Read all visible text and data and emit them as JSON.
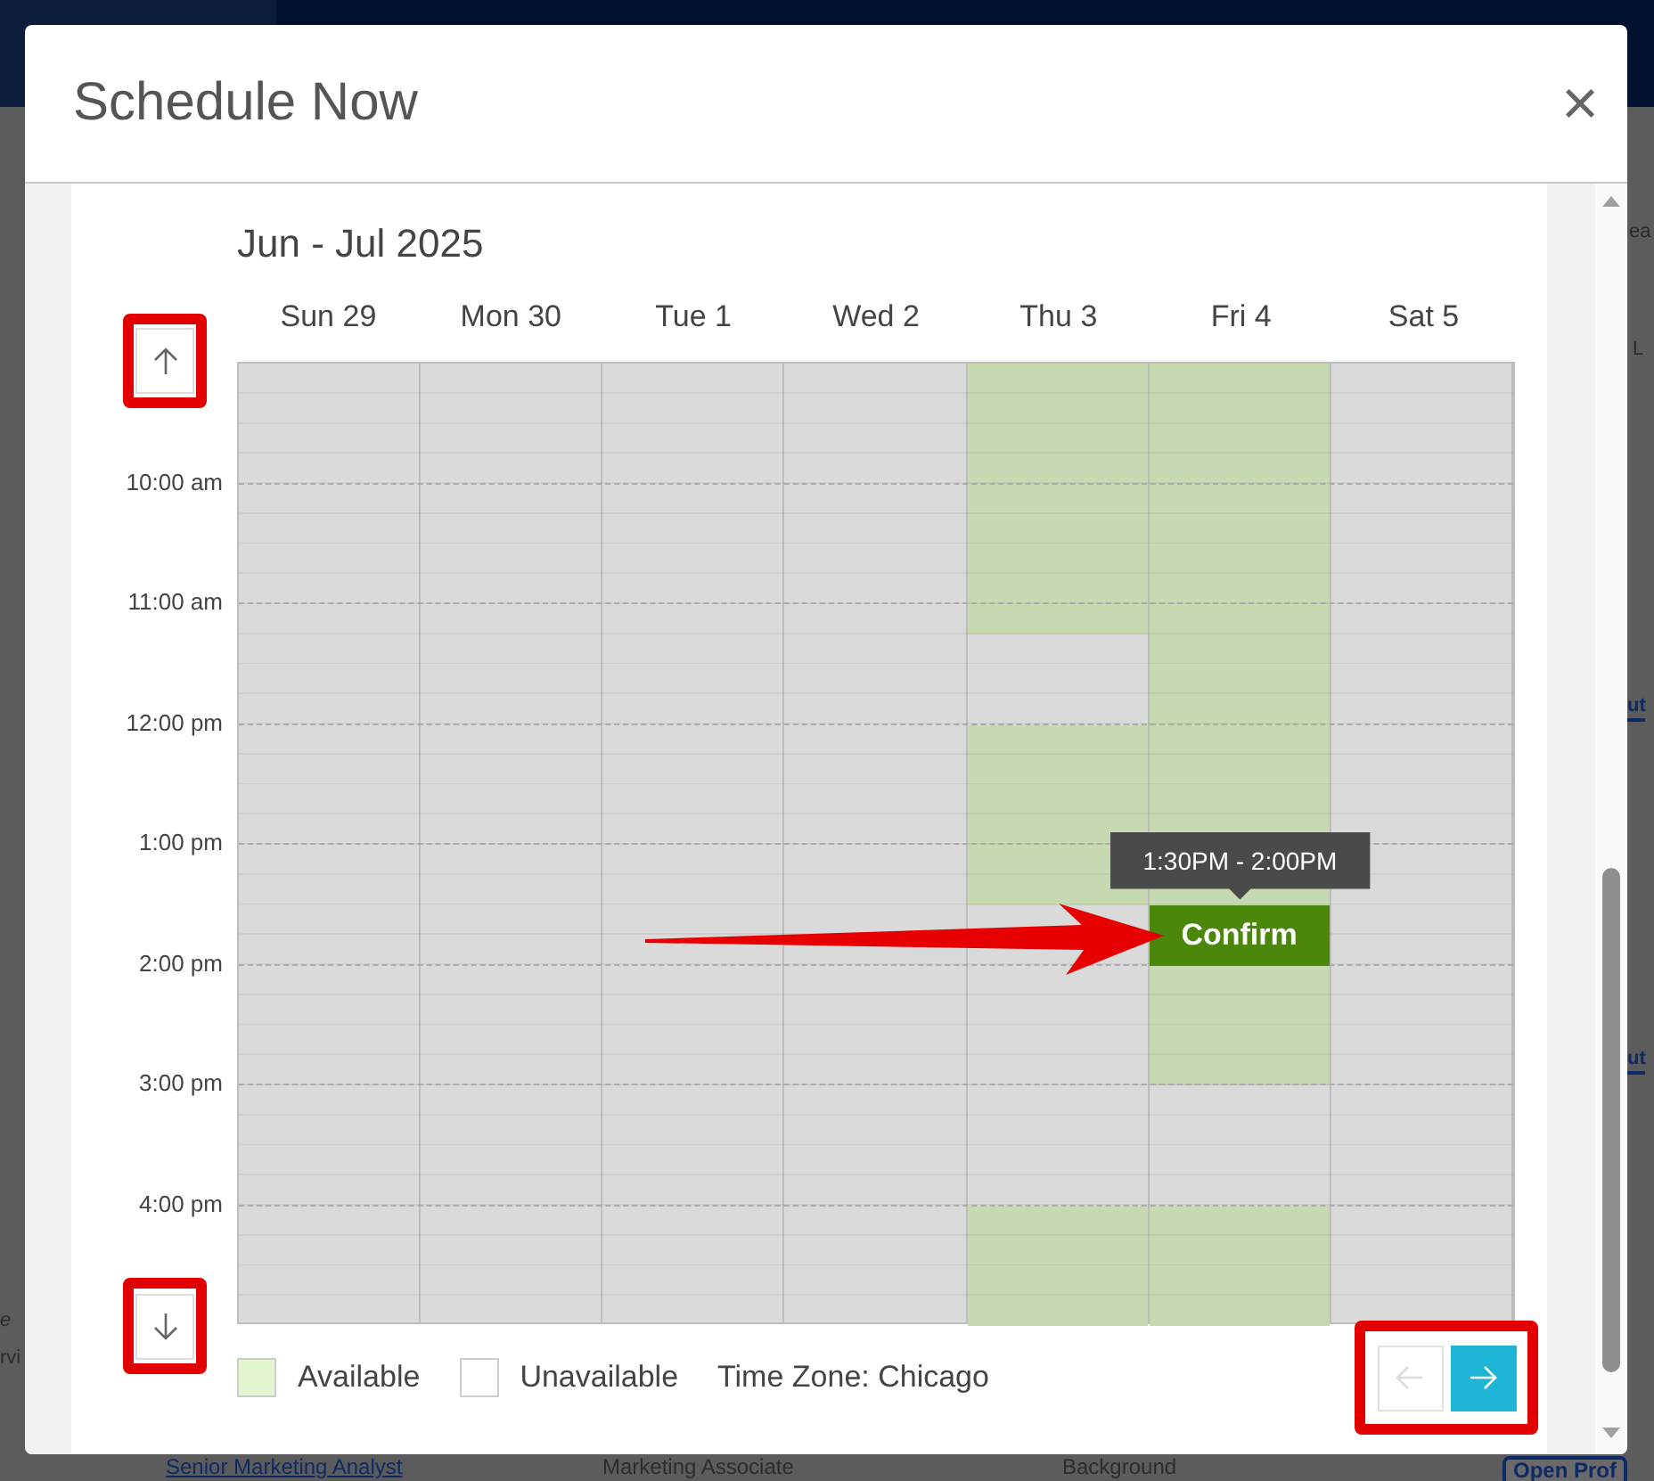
{
  "background": {
    "fragments": [
      {
        "text": "ea",
        "kind": "plain"
      },
      {
        "text": "L",
        "kind": "plain"
      },
      {
        "text": "ut",
        "kind": "link"
      },
      {
        "text": "ut",
        "kind": "link"
      },
      {
        "text": "e",
        "kind": "italic"
      },
      {
        "text": "rvi",
        "kind": "plain"
      }
    ],
    "row": [
      {
        "text": "Senior Marketing Analyst",
        "kind": "link"
      },
      {
        "text": "Marketing Associate",
        "kind": "plain"
      },
      {
        "text": "Background",
        "kind": "plain"
      },
      {
        "text": "Open Prof",
        "kind": "button"
      }
    ]
  },
  "dialog": {
    "title": "Schedule Now",
    "close": "×"
  },
  "calendar": {
    "title": "Jun - Jul 2025",
    "times": [
      "10:00 am",
      "11:00 am",
      "12:00 pm",
      "1:00 pm",
      "2:00 pm",
      "3:00 pm",
      "4:00 pm"
    ],
    "days": [
      {
        "label": "Sun 29"
      },
      {
        "label": "Mon 30"
      },
      {
        "label": "Tue 1"
      },
      {
        "label": "Wed 2"
      },
      {
        "label": "Thu 3",
        "quarters": [
          {
            "available": true
          },
          {
            "available": true
          },
          {
            "available": true
          },
          {
            "available": true
          },
          {
            "available": true
          },
          {
            "available": true
          },
          {
            "available": true
          },
          {
            "available": true
          },
          {
            "available": true
          },
          {
            "available": false
          },
          {
            "available": false
          },
          {
            "available": false
          },
          {
            "available": true
          },
          {
            "available": true
          },
          {
            "available": true
          },
          {
            "available": true
          },
          {
            "available": true
          },
          {
            "available": true
          },
          {
            "available": false
          },
          {
            "available": false
          },
          {
            "available": false
          },
          {
            "available": false
          },
          {
            "available": false
          },
          {
            "available": false
          },
          {
            "available": false
          },
          {
            "available": false
          },
          {
            "available": false
          },
          {
            "available": false
          },
          {
            "available": true
          },
          {
            "available": true
          },
          {
            "available": true
          },
          {
            "available": true
          }
        ]
      },
      {
        "label": "Fri 4",
        "quarters": [
          {
            "available": true
          },
          {
            "available": true
          },
          {
            "available": true
          },
          {
            "available": true
          },
          {
            "available": true
          },
          {
            "available": true
          },
          {
            "available": true
          },
          {
            "available": true
          },
          {
            "available": true
          },
          {
            "available": true
          },
          {
            "available": true
          },
          {
            "available": true
          },
          {
            "available": true
          },
          {
            "available": true
          },
          {
            "available": true
          },
          {
            "available": true
          },
          {
            "kind": "covered"
          },
          {
            "available": true
          },
          {
            "kind": "confirm"
          },
          {
            "kind": "confirm"
          },
          {
            "available": true
          },
          {
            "available": true
          },
          {
            "available": true
          },
          {
            "available": true
          },
          {
            "available": false
          },
          {
            "available": false
          },
          {
            "available": false
          },
          {
            "available": false
          },
          {
            "available": true
          },
          {
            "available": true
          },
          {
            "available": true
          },
          {
            "available": true
          }
        ],
        "selection": {
          "tooltip": "1:30PM - 2:00PM",
          "button": "Confirm"
        }
      },
      {
        "label": "Sat 5"
      }
    ],
    "legend": [
      {
        "label": "Available",
        "kind": "available"
      },
      {
        "label": "Unavailable",
        "kind": "unavailable"
      }
    ],
    "timezone": "Time Zone: Chicago",
    "nav": {
      "prev": {
        "disabled": true
      },
      "next": {
        "disabled": false
      }
    }
  }
}
